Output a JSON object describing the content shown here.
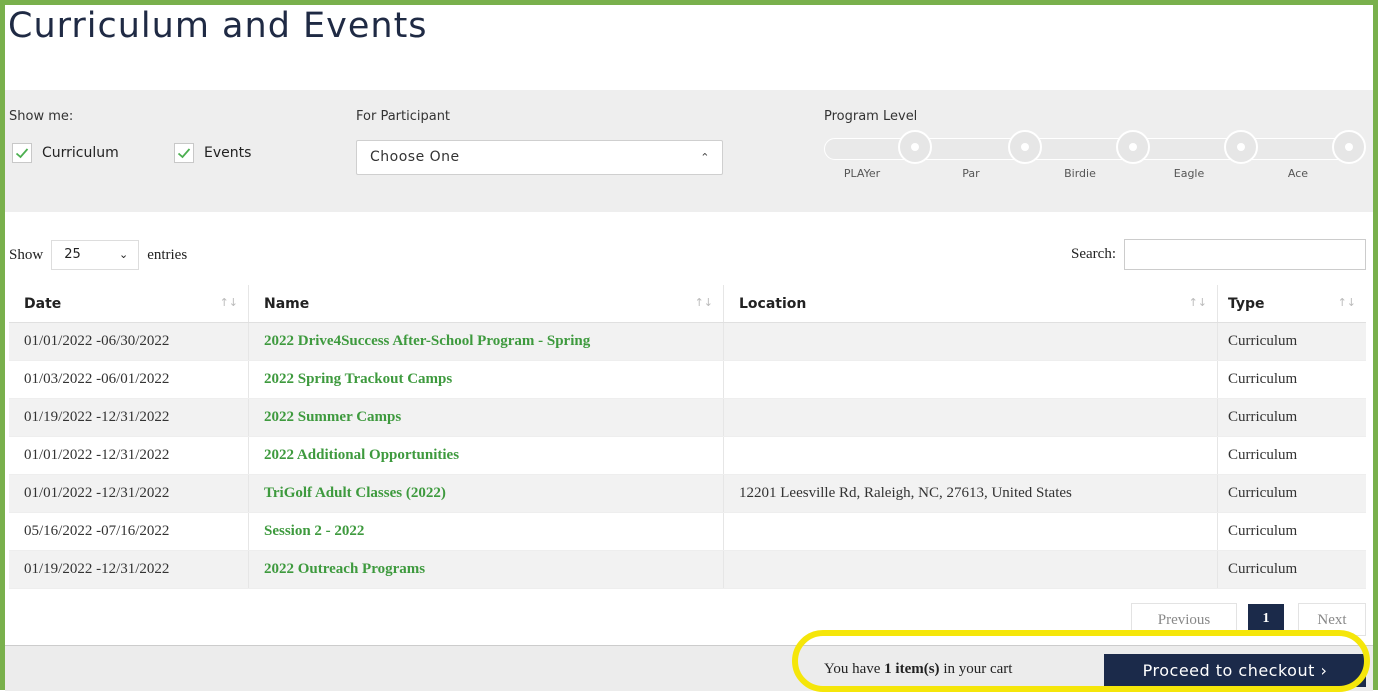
{
  "page": {
    "title": "Curriculum and Events"
  },
  "filters": {
    "show_me_label": "Show me:",
    "checkboxes": [
      {
        "label": "Curriculum",
        "checked": true
      },
      {
        "label": "Events",
        "checked": true
      }
    ],
    "participant_label": "For Participant",
    "participant_value": "Choose One",
    "program_level_label": "Program Level",
    "program_levels": [
      "PLAYer",
      "Par",
      "Birdie",
      "Eagle",
      "Ace"
    ]
  },
  "table_controls": {
    "show_label": "Show",
    "entries_value": "25",
    "entries_label": "entries",
    "search_label": "Search:",
    "search_value": ""
  },
  "table": {
    "columns": [
      "Date",
      "Name",
      "Location",
      "Type"
    ],
    "rows": [
      {
        "date": "01/01/2022 -06/30/2022",
        "name": "2022 Drive4Success After-School Program - Spring",
        "location": "",
        "type": "Curriculum"
      },
      {
        "date": "01/03/2022 -06/01/2022",
        "name": "2022 Spring Trackout Camps",
        "location": "",
        "type": "Curriculum"
      },
      {
        "date": "01/19/2022 -12/31/2022",
        "name": "2022 Summer Camps",
        "location": "",
        "type": "Curriculum"
      },
      {
        "date": "01/01/2022 -12/31/2022",
        "name": "2022 Additional Opportunities",
        "location": "",
        "type": "Curriculum"
      },
      {
        "date": "01/01/2022 -12/31/2022",
        "name": "TriGolf Adult Classes (2022)",
        "location": "12201 Leesville Rd, Raleigh, NC, 27613, United States",
        "type": "Curriculum"
      },
      {
        "date": "05/16/2022 -07/16/2022",
        "name": "Session 2 - 2022",
        "location": "",
        "type": "Curriculum"
      },
      {
        "date": "01/19/2022 -12/31/2022",
        "name": "2022 Outreach Programs",
        "location": "",
        "type": "Curriculum"
      }
    ]
  },
  "pagination": {
    "previous": "Previous",
    "current": "1",
    "next": "Next"
  },
  "cart": {
    "prefix": "You have",
    "count": "1 item(s)",
    "suffix": "in your cart",
    "checkout_label": "Proceed to checkout ›"
  },
  "colors": {
    "frame": "#79b04c",
    "link_green": "#3e9a3e",
    "navy": "#1b2a4a",
    "highlight": "#f5e60a"
  }
}
